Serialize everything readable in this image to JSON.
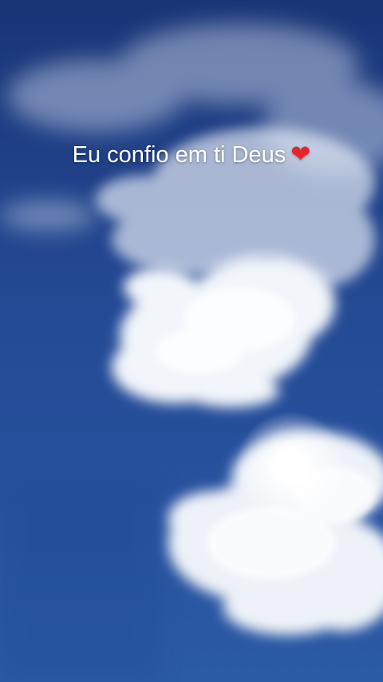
{
  "caption": {
    "text": "Eu confio em ti Deus",
    "emoji": "❤",
    "color": "#ffffff",
    "emoji_color": "#e8232c"
  },
  "scene": {
    "subject": "blue-sky-with-clouds",
    "sky_color_top": "#1b3a7e",
    "sky_color_bottom": "#2a4f9c",
    "cloud_color": "#eef2f8"
  }
}
